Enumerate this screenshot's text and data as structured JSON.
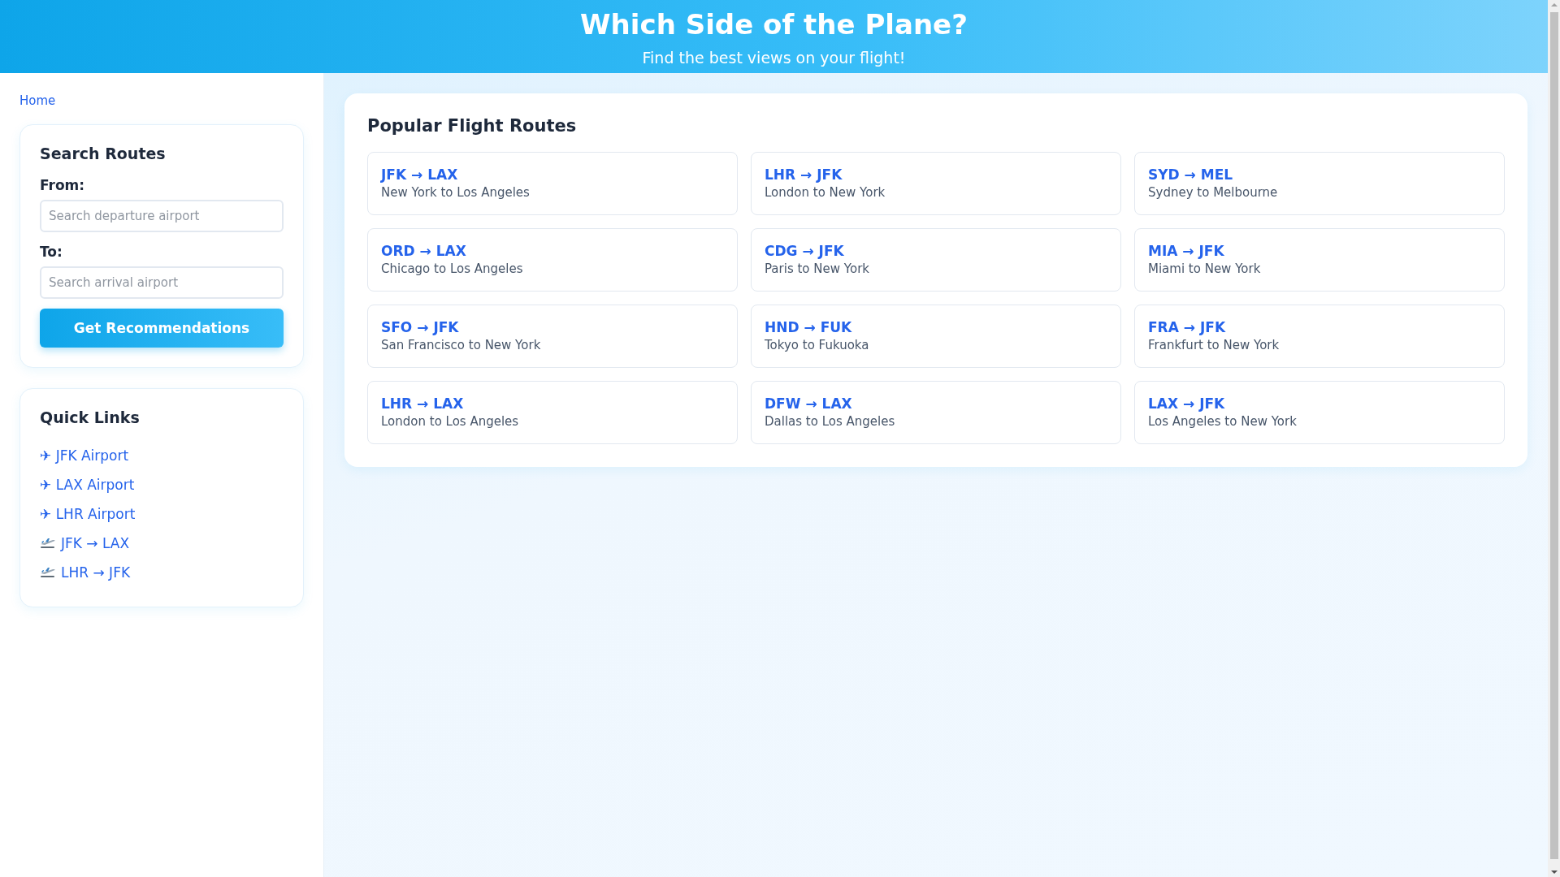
{
  "header": {
    "title": "Which Side of the Plane?",
    "subtitle": "Find the best views on your flight!"
  },
  "breadcrumb": "Home",
  "search": {
    "title": "Search Routes",
    "from_label": "From:",
    "from_placeholder": "Search departure airport",
    "to_label": "To:",
    "to_placeholder": "Search arrival airport",
    "button": "Get Recommendations"
  },
  "quick_links": {
    "title": "Quick Links",
    "items": [
      {
        "kind": "airport",
        "label": "✈ JFK Airport"
      },
      {
        "kind": "airport",
        "label": "✈ LAX Airport"
      },
      {
        "kind": "airport",
        "label": "✈ LHR Airport"
      },
      {
        "kind": "route",
        "label": "JFK → LAX"
      },
      {
        "kind": "route",
        "label": "LHR → JFK"
      }
    ]
  },
  "popular": {
    "title": "Popular Flight Routes",
    "routes": [
      {
        "code": "JFK → LAX",
        "name": "New York to Los Angeles"
      },
      {
        "code": "LHR → JFK",
        "name": "London to New York"
      },
      {
        "code": "SYD → MEL",
        "name": "Sydney to Melbourne"
      },
      {
        "code": "ORD → LAX",
        "name": "Chicago to Los Angeles"
      },
      {
        "code": "CDG → JFK",
        "name": "Paris to New York"
      },
      {
        "code": "MIA → JFK",
        "name": "Miami to New York"
      },
      {
        "code": "SFO → JFK",
        "name": "San Francisco to New York"
      },
      {
        "code": "HND → FUK",
        "name": "Tokyo to Fukuoka"
      },
      {
        "code": "FRA → JFK",
        "name": "Frankfurt to New York"
      },
      {
        "code": "LHR → LAX",
        "name": "London to Los Angeles"
      },
      {
        "code": "DFW → LAX",
        "name": "Dallas to Los Angeles"
      },
      {
        "code": "LAX → JFK",
        "name": "Los Angeles to New York"
      }
    ]
  }
}
